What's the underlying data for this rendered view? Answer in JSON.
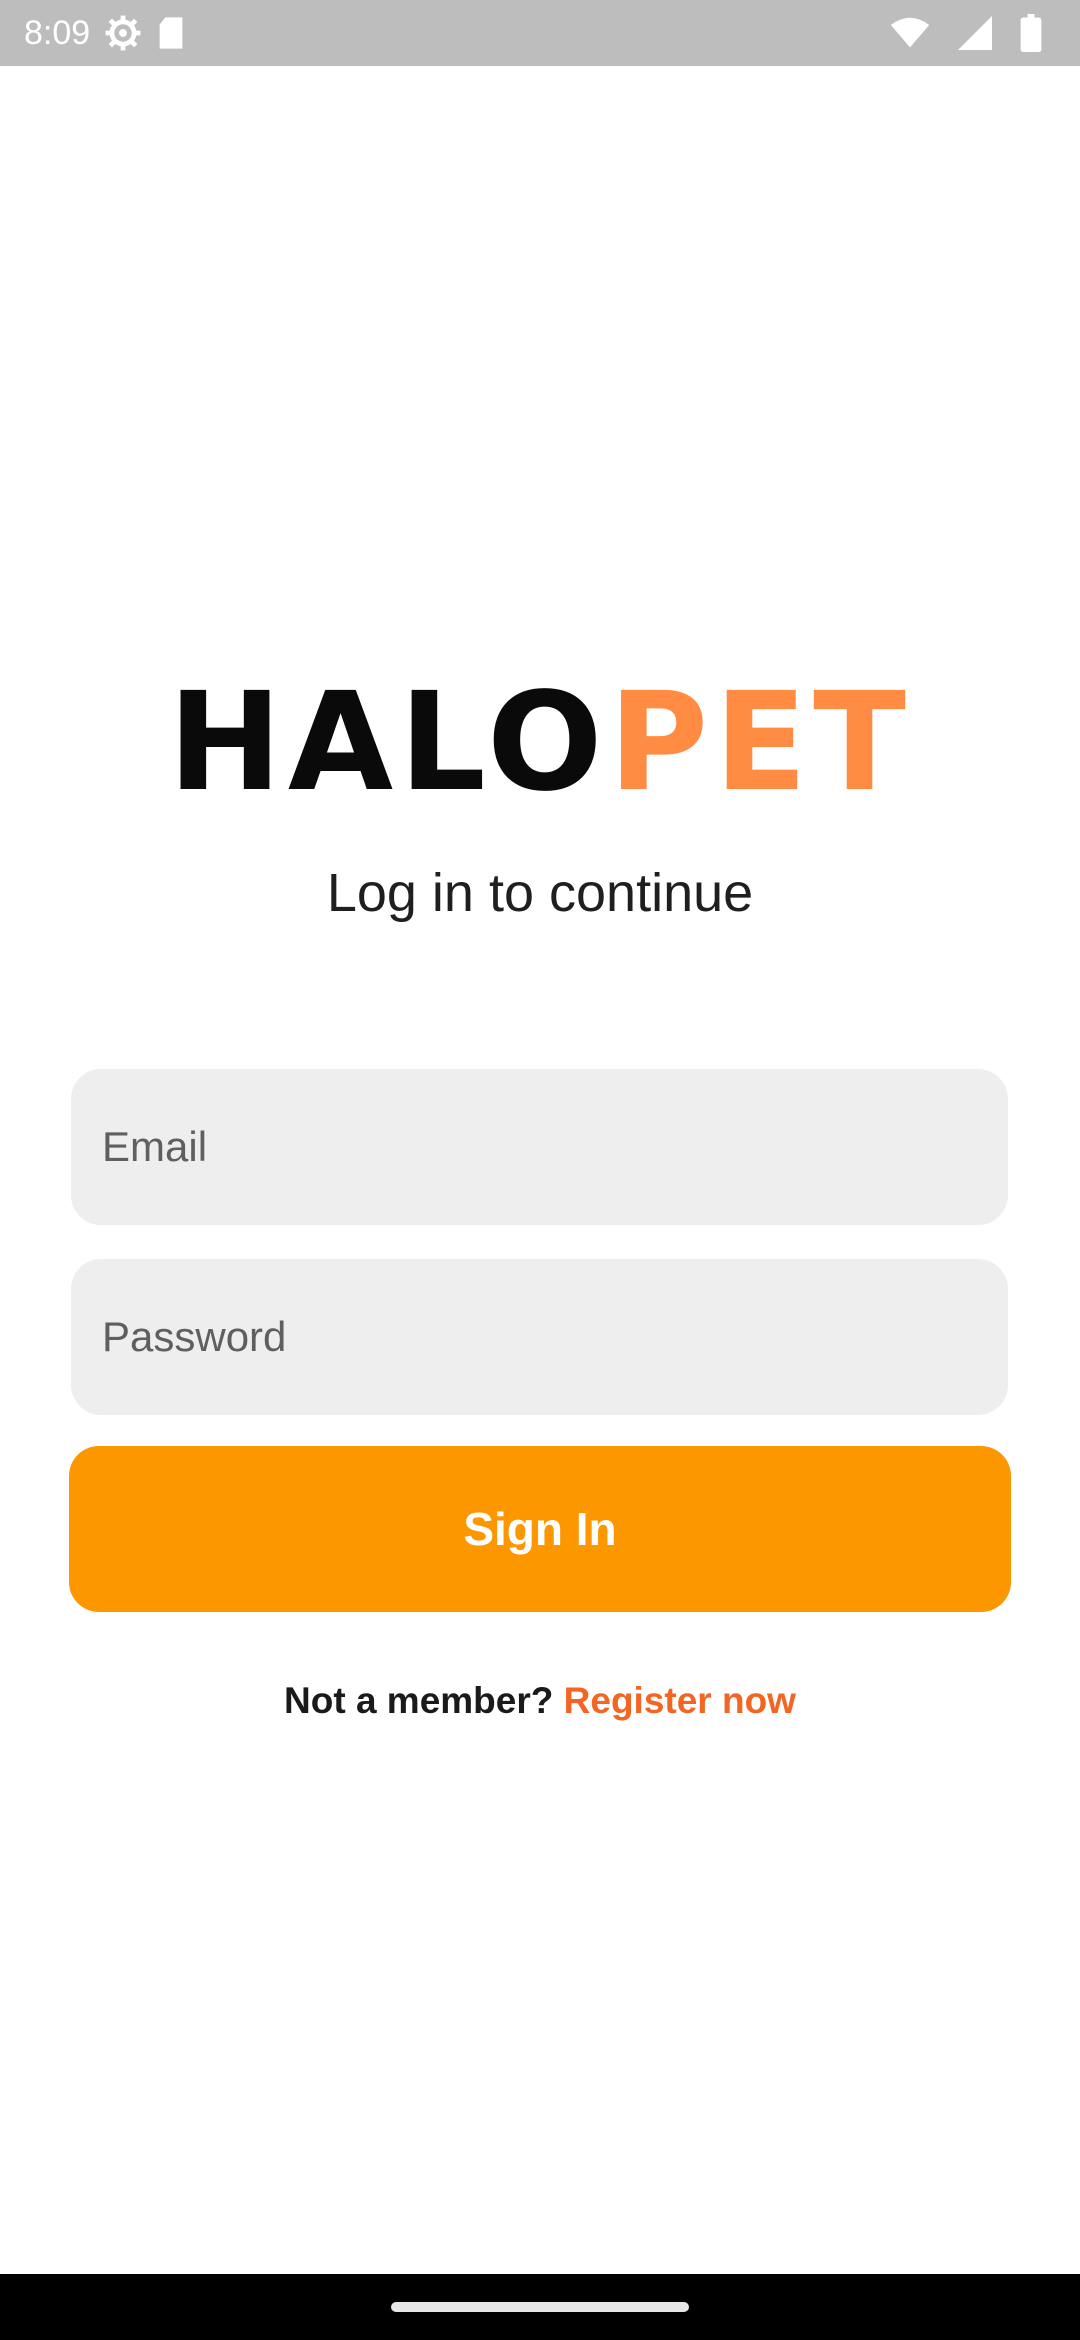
{
  "status_bar": {
    "time": "8:09",
    "icons": [
      "settings-icon",
      "sd-card-icon",
      "wifi-icon",
      "signal-icon",
      "battery-icon"
    ]
  },
  "logo": {
    "part_dark": "HALO",
    "part_accent": "PET",
    "colors": {
      "dark": "#0a0a0a",
      "accent": "#ff8c42"
    }
  },
  "subtitle": "Log in to continue",
  "form": {
    "email_placeholder": "Email",
    "email_value": "",
    "password_placeholder": "Password",
    "password_value": "",
    "signin_label": "Sign In"
  },
  "register": {
    "prompt": "Not a member?",
    "link": "Register now"
  },
  "colors": {
    "primary_button": "#fd9700",
    "link": "#f26522",
    "field_background": "#eeeeee",
    "status_bar": "#bdbdbd"
  }
}
